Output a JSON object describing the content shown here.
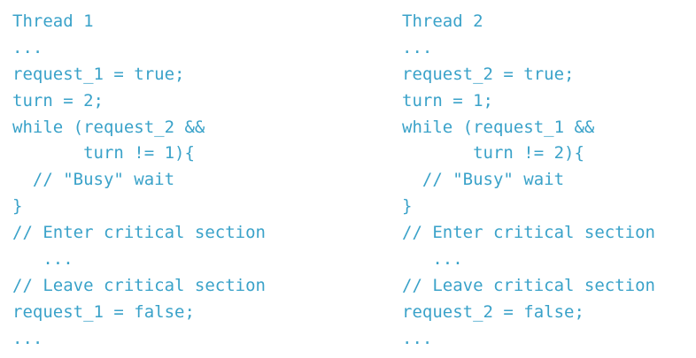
{
  "colors": {
    "code_text": "#3aa2c9",
    "background": "#ffffff"
  },
  "thread_1": {
    "lines": [
      "Thread 1",
      "...",
      "request_1 = true;",
      "turn = 2;",
      "while (request_2 &&",
      "       turn != 1){",
      "  // \"Busy\" wait",
      "}",
      "// Enter critical section",
      "   ...",
      "// Leave critical section",
      "request_1 = false;",
      "..."
    ]
  },
  "thread_2": {
    "lines": [
      "Thread 2",
      "...",
      "request_2 = true;",
      "turn = 1;",
      "while (request_1 &&",
      "       turn != 2){",
      "  // \"Busy\" wait",
      "}",
      "// Enter critical section",
      "   ...",
      "// Leave critical section",
      "request_2 = false;",
      "..."
    ]
  }
}
